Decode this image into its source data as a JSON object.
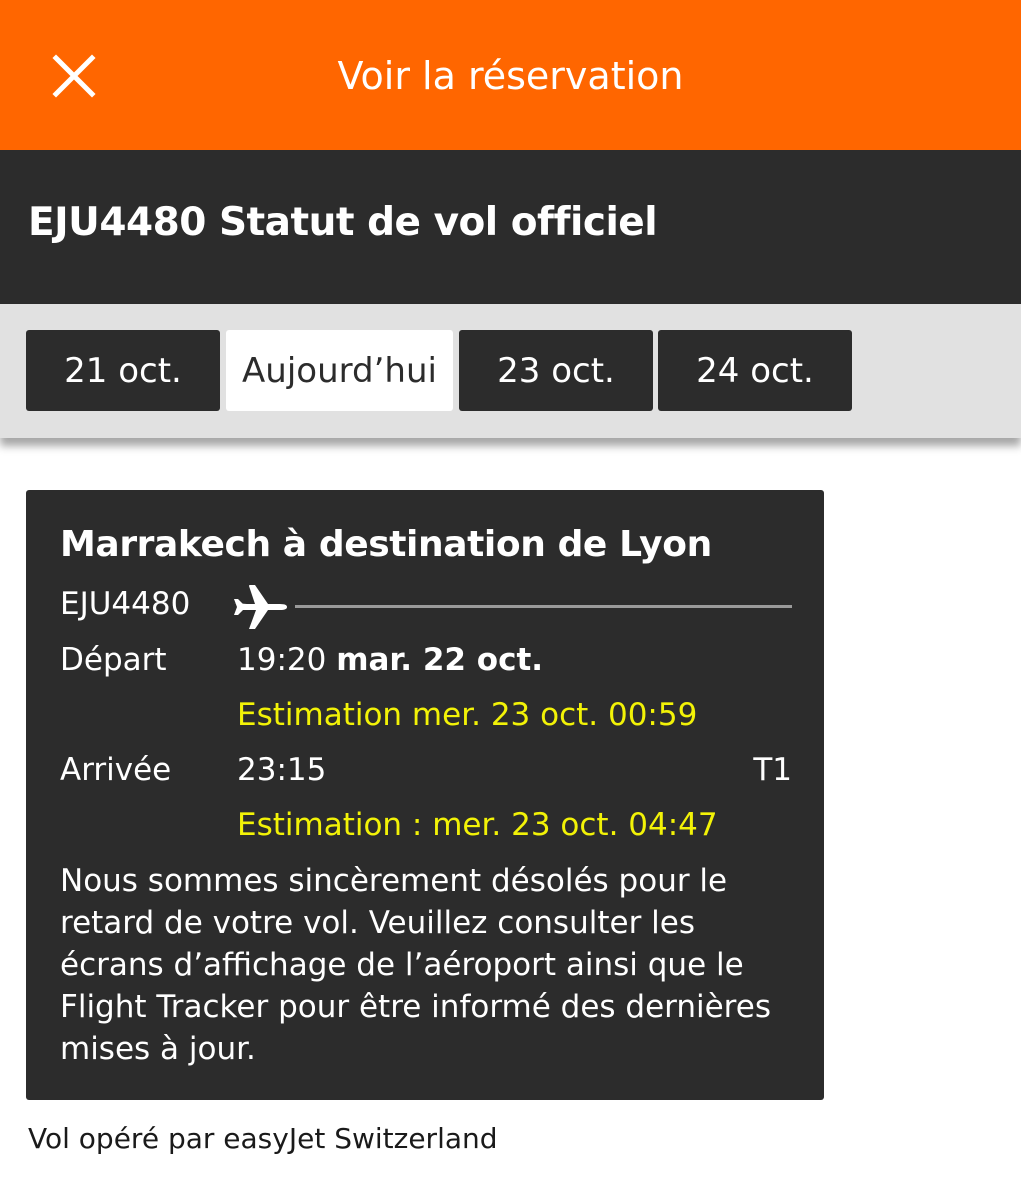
{
  "topbar": {
    "title": "Voir la réservation",
    "close_icon": "close-icon",
    "background_color": "#ff6600"
  },
  "status": {
    "title": "EJU4480 Statut de vol officiel"
  },
  "date_tabs": [
    {
      "label": "21 oct.",
      "active": false
    },
    {
      "label": "Aujourd’hui",
      "active": true
    },
    {
      "label": "23 oct.",
      "active": false
    },
    {
      "label": "24 oct.",
      "active": false
    }
  ],
  "flight_card": {
    "route_title": "Marrakech à destination de Lyon",
    "flight_number": "EJU4480",
    "plane_icon": "airplane-icon",
    "departure": {
      "label": "Départ",
      "time": "19:20",
      "date": "mar. 22 oct.",
      "estimate": "Estimation mer. 23 oct. 00:59"
    },
    "arrival": {
      "label": "Arrivée",
      "time": "23:15",
      "terminal": "T1",
      "estimate": "Estimation : mer. 23 oct. 04:47"
    },
    "message": "Nous sommes sincèrement désolés pour le retard de votre vol. Veuillez consulter les écrans d’affichage de l’aéroport ainsi que le Flight Tracker pour être informé des dernières mises à jour.",
    "estimate_color": "#f2f207"
  },
  "footer": {
    "operated_by": "Vol opéré par easyJet Switzerland"
  }
}
